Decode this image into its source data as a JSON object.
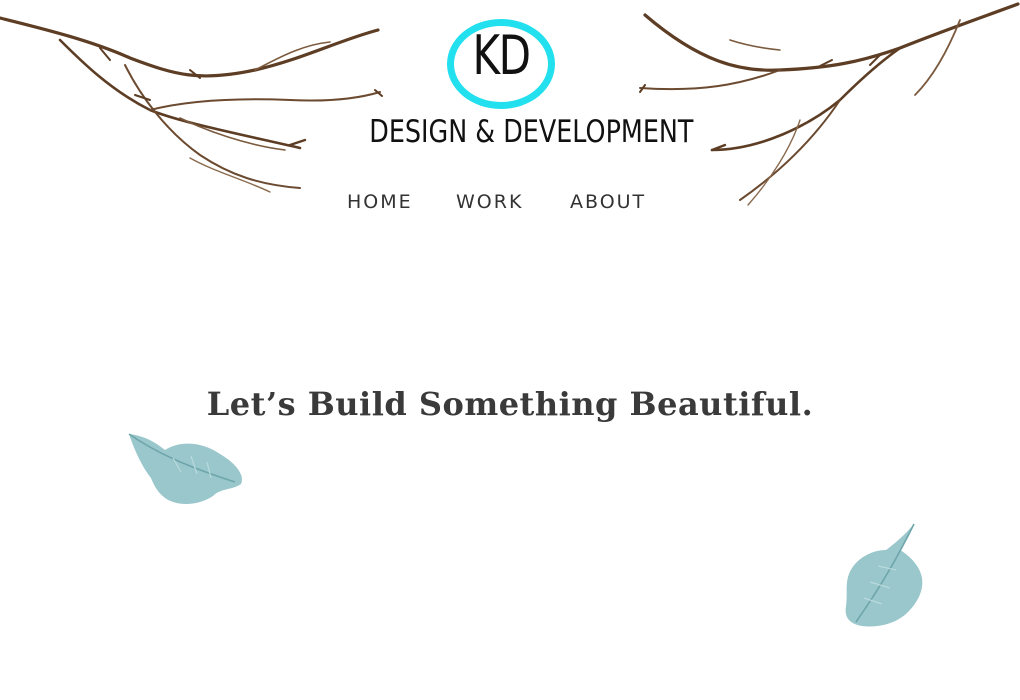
{
  "brand": {
    "monogram": "KD",
    "tagline": "DESIGN & DEVELOPMENT",
    "ring_color": "#22e0ee"
  },
  "nav": {
    "items": [
      {
        "label": "HOME"
      },
      {
        "label": "WORK"
      },
      {
        "label": "ABOUT"
      }
    ]
  },
  "hero": {
    "headline": "Let’s Build Something Beautiful."
  },
  "decor": {
    "branch_color": "#6b4a30",
    "leaf_color": "#8fc1c6"
  }
}
